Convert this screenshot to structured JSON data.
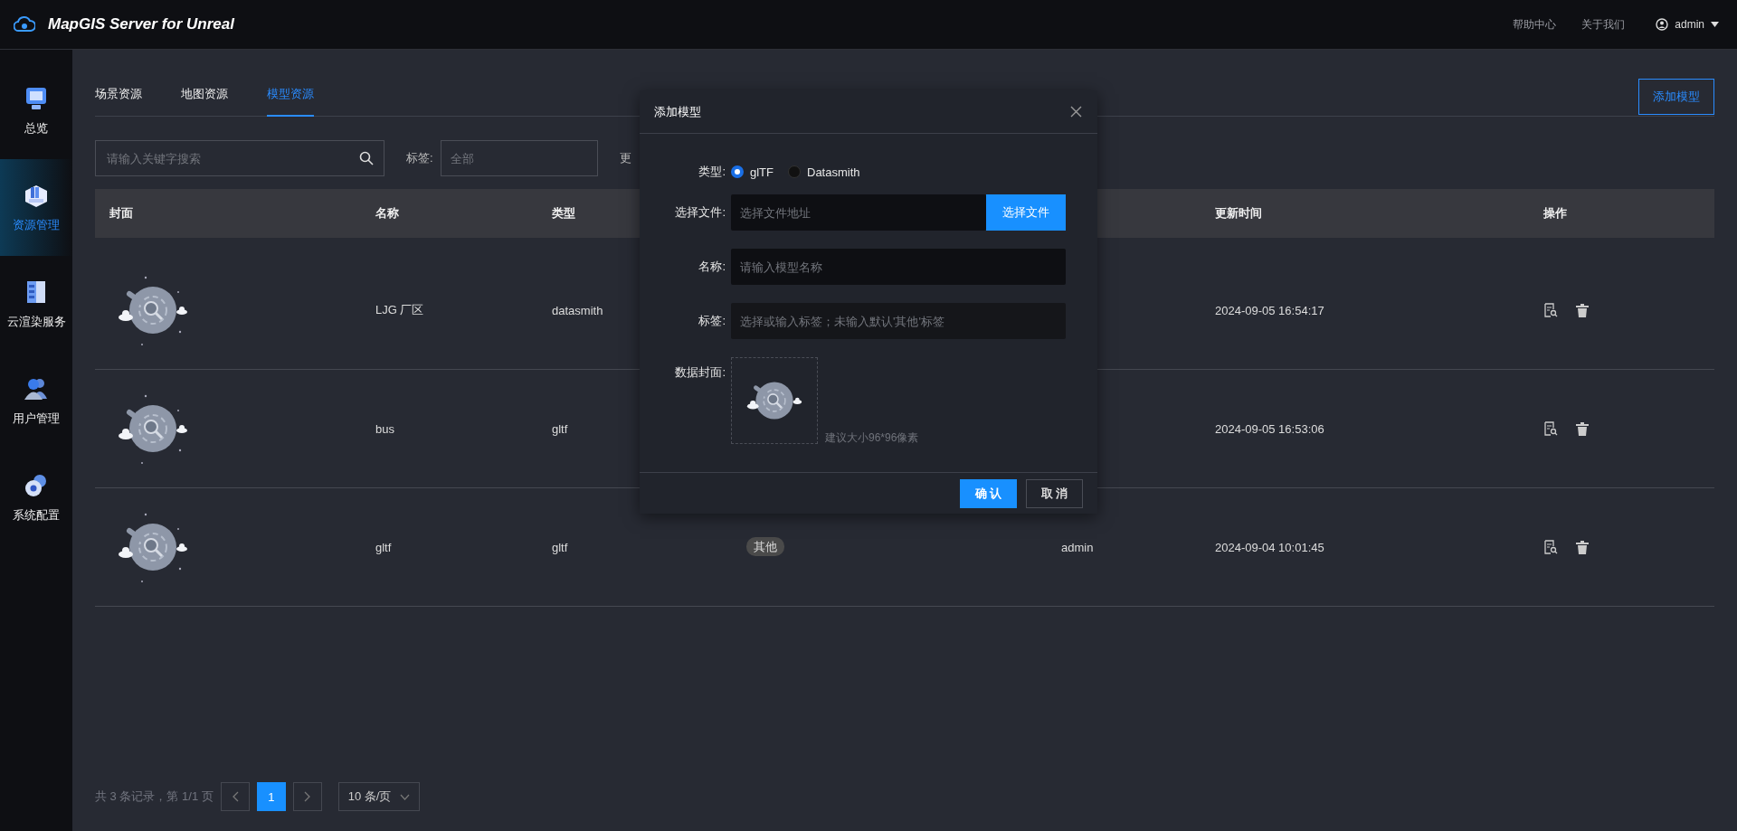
{
  "app": {
    "title": "MapGIS Server for Unreal"
  },
  "header_links": [
    {
      "label": "帮助中心"
    },
    {
      "label": "关于我们"
    }
  ],
  "user": {
    "name": "admin"
  },
  "sidebar": {
    "items": [
      {
        "label": "总览",
        "kind": "overview",
        "selected": false
      },
      {
        "label": "资源管理",
        "kind": "resources",
        "selected": true
      },
      {
        "label": "云渲染服务",
        "kind": "render",
        "selected": false
      },
      {
        "label": "用户管理",
        "kind": "users",
        "selected": false
      },
      {
        "label": "系统配置",
        "kind": "settings",
        "selected": false
      }
    ]
  },
  "tabs": [
    {
      "label": "场景资源",
      "selected": false
    },
    {
      "label": "地图资源",
      "selected": false
    },
    {
      "label": "模型资源",
      "selected": true
    }
  ],
  "add_button": "添加模型",
  "search": {
    "placeholder": "请输入关键字搜索"
  },
  "tag_filter": {
    "label": "标签:",
    "placeholder": "全部"
  },
  "filter_3": {
    "label": "更"
  },
  "table": {
    "columns": [
      {
        "label": "封面"
      },
      {
        "label": "名称"
      },
      {
        "label": "类型"
      },
      {
        "label": "更新时间"
      },
      {
        "label": "操作"
      }
    ],
    "rows": [
      {
        "name": "LJG 厂区",
        "type": "datasmith",
        "updated": "2024-09-05 16:54:17"
      },
      {
        "name": "bus",
        "type": "gltf",
        "updated": "2024-09-05 16:53:06"
      },
      {
        "name": "gltf",
        "type": "gltf",
        "tag": "其他",
        "creator": "admin",
        "updated": "2024-09-04 10:01:45"
      }
    ]
  },
  "pagination": {
    "summary": "共 3 条记录，第 1/1 页",
    "pages": [
      {
        "label": "1",
        "selected": true
      }
    ],
    "page_size": "10 条/页"
  },
  "dialog": {
    "title": "添加模型",
    "type_label": "类型:",
    "type_options": [
      {
        "label": "glTF",
        "selected": true
      },
      {
        "label": "Datasmith",
        "selected": false
      }
    ],
    "file_label": "选择文件:",
    "file_placeholder": "选择文件地址",
    "file_button": "选择文件",
    "name_label": "名称:",
    "name_placeholder": "请输入模型名称",
    "tag_label": "标签:",
    "tag_placeholder": "选择或输入标签；未输入默认'其他'标签",
    "cover_label": "数据封面:",
    "cover_hint": "建议大小96*96像素",
    "confirm": "确 认",
    "cancel": "取 消"
  }
}
